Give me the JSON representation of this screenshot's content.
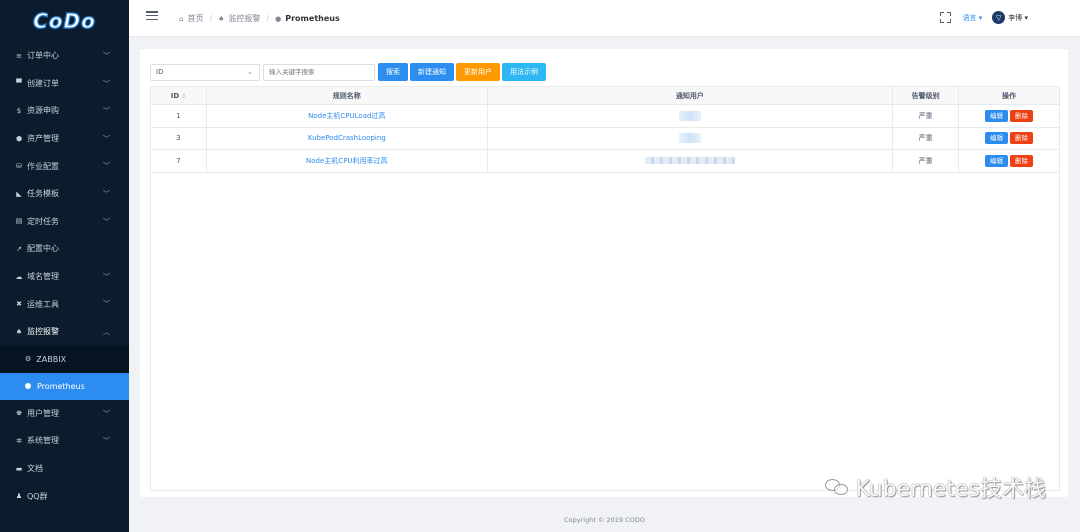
{
  "brand": {
    "logo_text": "CoDo"
  },
  "sidebar": {
    "items": [
      {
        "label": "订单中心",
        "icon": "list-icon",
        "glyph": "≡",
        "chevron": true
      },
      {
        "label": "创建订单",
        "icon": "cart-icon",
        "glyph": "▀",
        "chevron": true
      },
      {
        "label": "资源申购",
        "icon": "dollar-icon",
        "glyph": "$",
        "chevron": true
      },
      {
        "label": "资产管理",
        "icon": "cube-icon",
        "glyph": "⬢",
        "chevron": true
      },
      {
        "label": "作业配置",
        "icon": "database-icon",
        "glyph": "⛁",
        "chevron": true
      },
      {
        "label": "任务模板",
        "icon": "tag-icon",
        "glyph": "◣",
        "chevron": true
      },
      {
        "label": "定时任务",
        "icon": "calendar-icon",
        "glyph": "▤",
        "chevron": true
      },
      {
        "label": "配置中心",
        "icon": "wrench-icon",
        "glyph": "↗",
        "chevron": false
      },
      {
        "label": "域名管理",
        "icon": "cloud-icon",
        "glyph": "☁",
        "chevron": true
      },
      {
        "label": "运维工具",
        "icon": "tools-icon",
        "glyph": "✖",
        "chevron": true
      },
      {
        "label": "监控报警",
        "icon": "bell-icon",
        "glyph": "♠",
        "chevron": true,
        "open": true
      }
    ],
    "subitems": [
      {
        "label": "ZABBIX",
        "icon": "gear-small-icon",
        "glyph": "⚙",
        "active": false
      },
      {
        "label": "Prometheus",
        "icon": "dot-icon",
        "active": true
      }
    ],
    "items_after": [
      {
        "label": "用户管理",
        "icon": "users-icon",
        "glyph": "♚",
        "chevron": true
      },
      {
        "label": "系统管理",
        "icon": "gear-icon",
        "glyph": "✲",
        "chevron": true
      },
      {
        "label": "文档",
        "icon": "book-icon",
        "glyph": "▬",
        "chevron": false
      },
      {
        "label": "QQ群",
        "icon": "qq-icon",
        "glyph": "♟",
        "chevron": false
      }
    ]
  },
  "header": {
    "breadcrumb": [
      "首页",
      "监控报警",
      "Prometheus"
    ],
    "language": "语言",
    "user": "李博"
  },
  "toolbar": {
    "select_value": "ID",
    "search_placeholder": "输入关键字搜索",
    "btn_search": "搜索",
    "btn_new": "新建通知",
    "btn_update": "更新用户",
    "btn_usage": "用法示例"
  },
  "table": {
    "headers": [
      "ID",
      "规则名称",
      "通知用户",
      "告警级别",
      "操作"
    ],
    "rows": [
      {
        "id": "1",
        "rule": "Node主机CPULoad过高",
        "level": "严重",
        "edit": "编辑",
        "del": "删除"
      },
      {
        "id": "3",
        "rule": "KubePodCrashLooping",
        "level": "严重",
        "edit": "编辑",
        "del": "删除"
      },
      {
        "id": "7",
        "rule": "Node主机CPU利用率过高",
        "level": "严重",
        "edit": "编辑",
        "del": "删除"
      }
    ]
  },
  "footer": "Copyright © 2019 CODO",
  "watermark": "Kubernetes技术栈",
  "colors": {
    "sidebar": "#0b1c2d",
    "primary": "#2d8cf0",
    "warning": "#ff9900",
    "info": "#2db7f5",
    "danger": "#ed4014"
  }
}
